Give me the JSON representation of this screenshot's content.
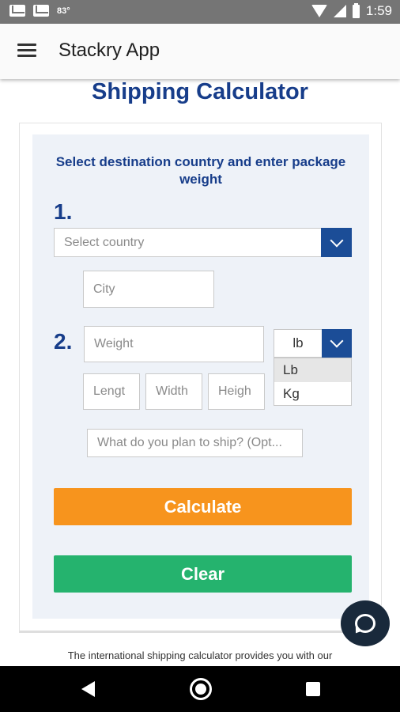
{
  "status_bar": {
    "temperature": "83°",
    "time": "1:59"
  },
  "app_bar": {
    "title": "Stackry App"
  },
  "page": {
    "title": "Shipping Calculator"
  },
  "form": {
    "instruction": "Select destination country and enter package weight",
    "step1_label": "1.",
    "step2_label": "2.",
    "country_placeholder": "Select country",
    "city_placeholder": "City",
    "weight_placeholder": "Weight",
    "unit_selected": "lb",
    "unit_options": [
      "Lb",
      "Kg"
    ],
    "length_placeholder": "Lengt",
    "width_placeholder": "Width",
    "height_placeholder": "Heigh",
    "contents_placeholder": "What do you plan to ship? (Opt..."
  },
  "buttons": {
    "calculate": "Calculate",
    "clear": "Clear"
  },
  "footer": {
    "text": "The international shipping calculator provides you with our"
  },
  "colors": {
    "brand_blue": "#173d8a",
    "calculate": "#f7941d",
    "clear": "#25b36e",
    "chat_fab": "#19293b"
  },
  "icons": [
    "mail-icon",
    "wifi-icon",
    "signal-icon",
    "battery-icon",
    "menu-icon",
    "chevron-down-icon",
    "chat-icon",
    "back-icon",
    "home-icon",
    "recents-icon"
  ]
}
